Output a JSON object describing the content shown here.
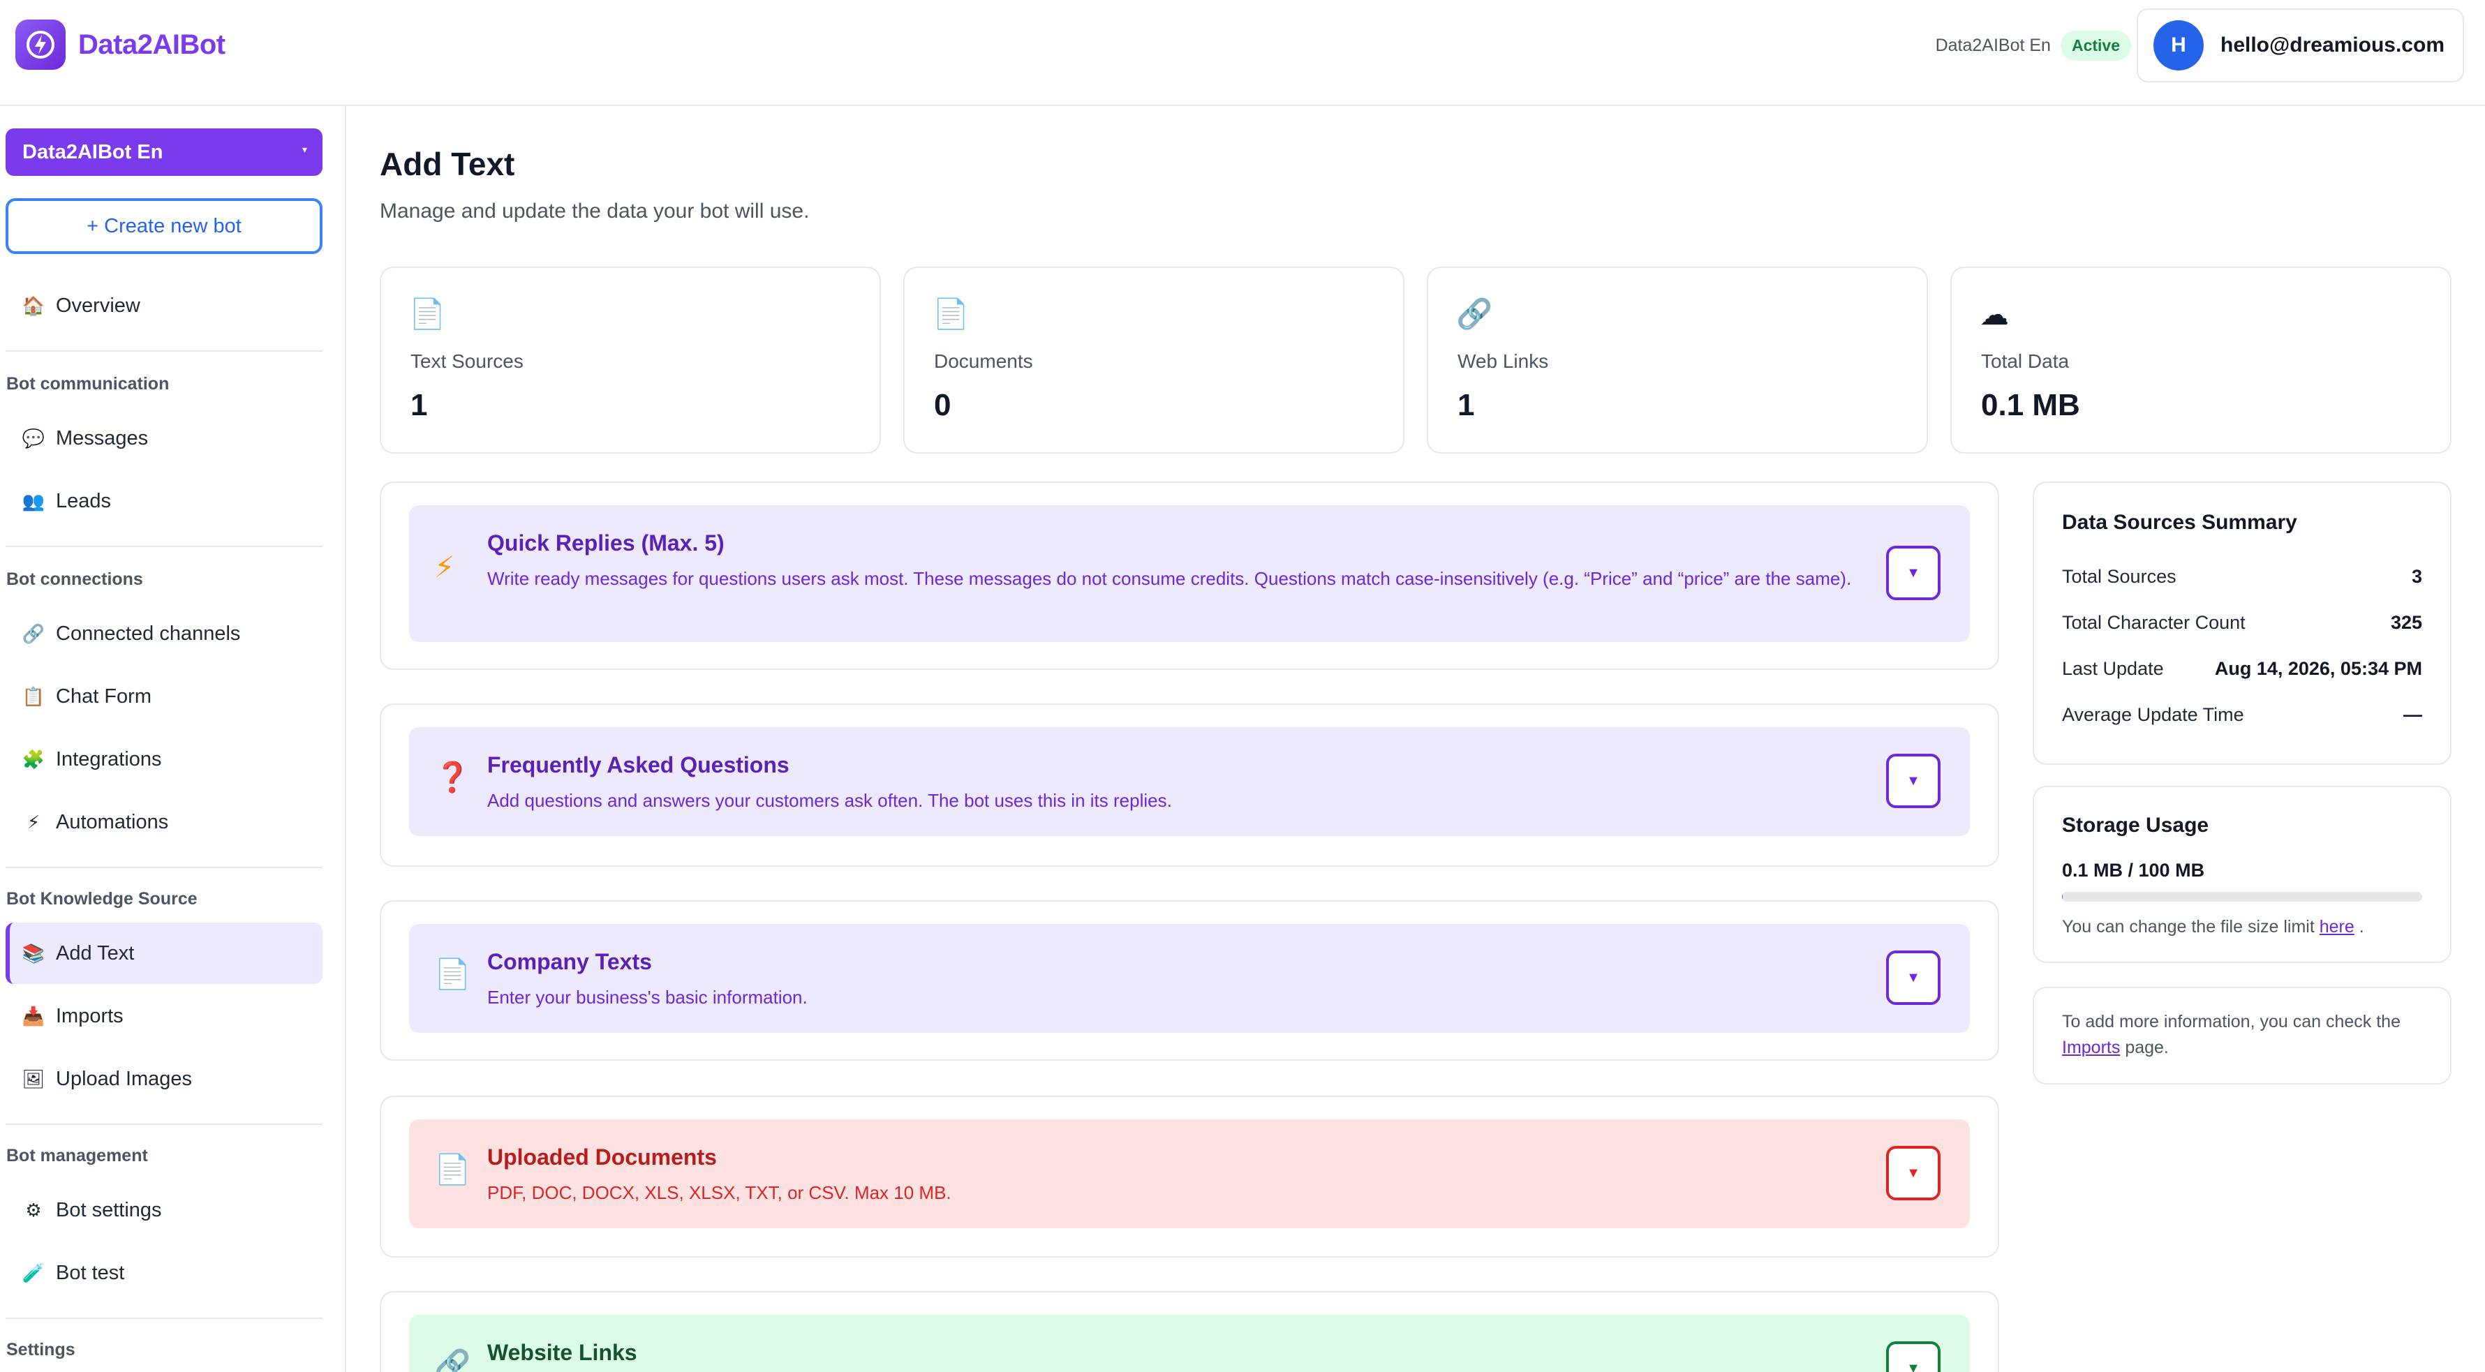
{
  "header": {
    "brand": "Data2AIBot",
    "bot_name": "Data2AIBot En",
    "status": "Active",
    "user_initial": "H",
    "user_email": "hello@dreamious.com"
  },
  "sidebar": {
    "bot_select": "Data2AIBot En",
    "create_button": "+ Create new bot",
    "overview": "Overview",
    "groups": {
      "communication": "Bot communication",
      "connections": "Bot connections",
      "knowledge": "Bot Knowledge Source",
      "management": "Bot management",
      "settings": "Settings"
    },
    "items": {
      "messages": "Messages",
      "leads": "Leads",
      "channels": "Connected channels",
      "chat_form": "Chat Form",
      "integrations": "Integrations",
      "automations": "Automations",
      "add_text": "Add Text",
      "imports": "Imports",
      "upload_images": "Upload Images",
      "bot_settings": "Bot settings",
      "bot_test": "Bot test"
    }
  },
  "page": {
    "title": "Add Text",
    "subtitle": "Manage and update the data your bot will use."
  },
  "stats": [
    {
      "icon": "document-icon",
      "label": "Text Sources",
      "value": "1"
    },
    {
      "icon": "document-icon",
      "label": "Documents",
      "value": "0"
    },
    {
      "icon": "link-icon",
      "label": "Web Links",
      "value": "1"
    },
    {
      "icon": "cloud-icon",
      "label": "Total Data",
      "value": "0.1 MB"
    }
  ],
  "sections": [
    {
      "title": "Quick Replies (Max. 5)",
      "desc": "Write ready messages for questions users ask most. These messages do not consume credits. Questions match case-insensitively (e.g. “Price” and “price” are the same)."
    },
    {
      "title": "Frequently Asked Questions",
      "desc": "Add questions and answers your customers ask often. The bot uses this in its replies."
    },
    {
      "title": "Company Texts",
      "desc": "Enter your business's basic information."
    },
    {
      "title": "Uploaded Documents",
      "desc": "PDF, DOC, DOCX, XLS, XLSX, TXT, or CSV. Max 10 MB."
    },
    {
      "title": "Website Links",
      "desc": ""
    }
  ],
  "summary": {
    "title": "Data Sources Summary",
    "rows": [
      {
        "label": "Total Sources",
        "value": "3"
      },
      {
        "label": "Total Character Count",
        "value": "325"
      },
      {
        "label": "Last Update",
        "value": "Aug 14, 2026, 05:34 PM"
      },
      {
        "label": "Average Update Time",
        "value": "—"
      }
    ]
  },
  "storage": {
    "title": "Storage Usage",
    "value": "0.1 MB / 100 MB",
    "used_fraction": 0.001,
    "note_prefix": "You can change the file size limit",
    "note_link": "here",
    "note_suffix": "."
  },
  "info": {
    "prefix": "To add more information, you can check the",
    "link": "Imports",
    "suffix": "page."
  },
  "colors": {
    "accent": "#7c3aed",
    "active_green": "#15803d",
    "danger": "#dc2626"
  }
}
